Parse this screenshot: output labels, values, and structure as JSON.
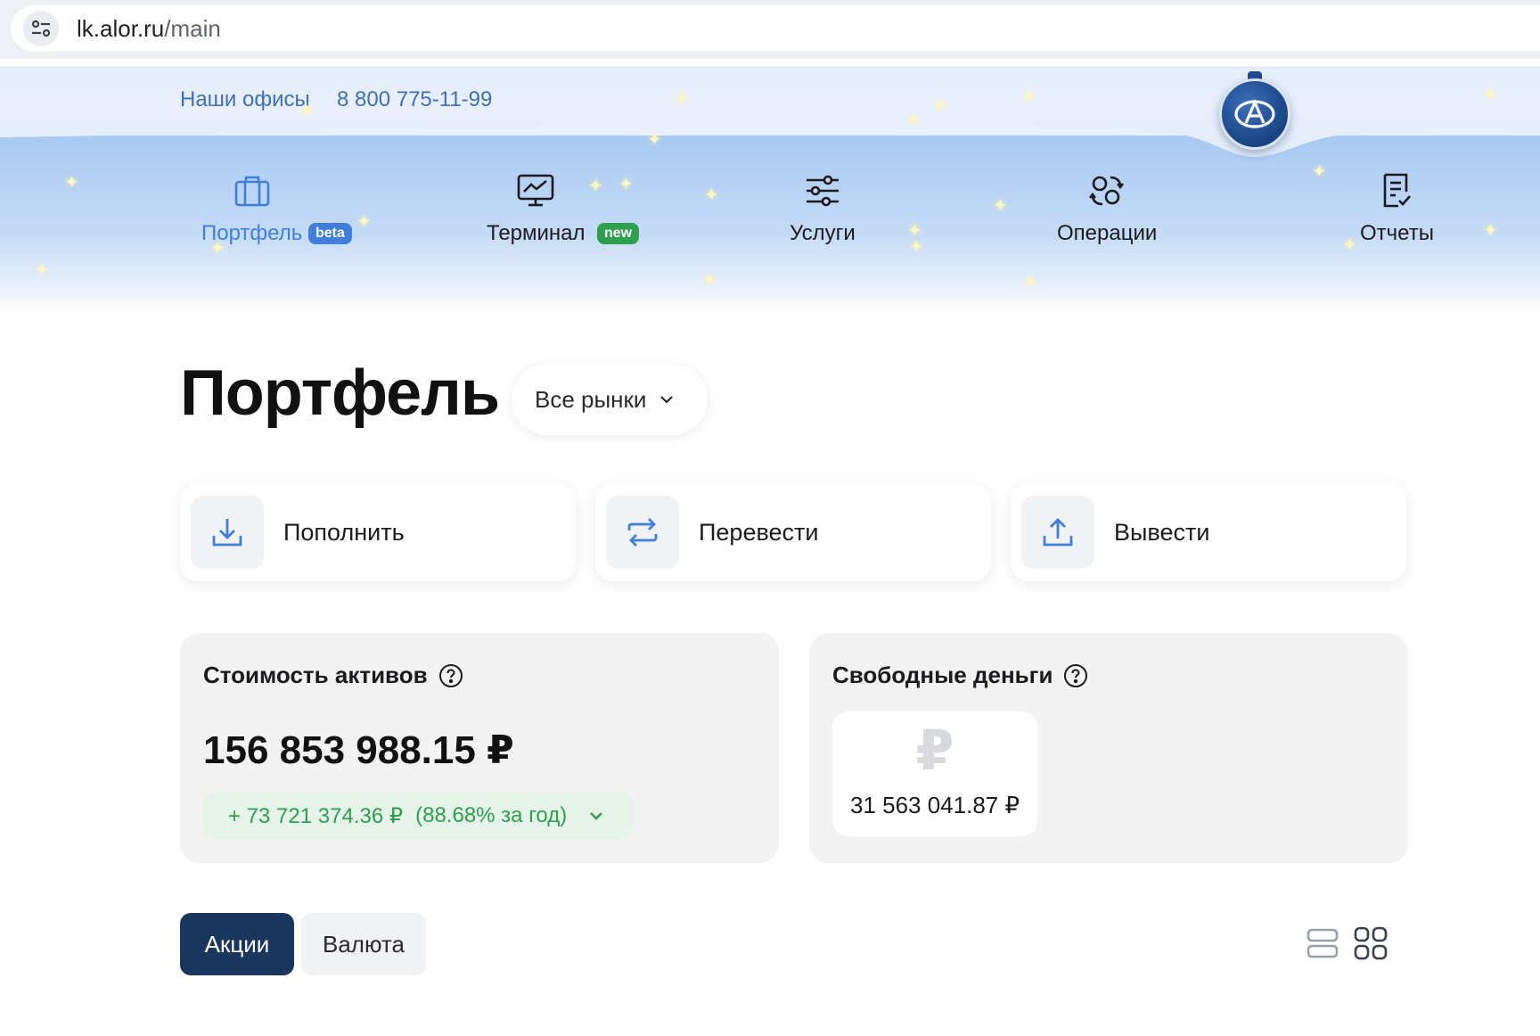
{
  "browser": {
    "url_host": "lk.alor.ru",
    "url_path": "/main",
    "site_settings_icon": "tune-icon"
  },
  "header": {
    "offices_link": "Наши офисы",
    "phone": "8 800 775-11-99",
    "logo_icon": "alor-logo-icon"
  },
  "nav": [
    {
      "label": "Портфель",
      "icon": "briefcase-icon",
      "badge": "beta",
      "active": true
    },
    {
      "label": "Терминал",
      "icon": "chart-monitor-icon",
      "badge": "new",
      "active": false
    },
    {
      "label": "Услуги",
      "icon": "sliders-icon",
      "badge": "",
      "active": false
    },
    {
      "label": "Операции",
      "icon": "exchange-icon",
      "badge": "",
      "active": false
    },
    {
      "label": "Отчеты",
      "icon": "report-icon",
      "badge": "",
      "active": false
    }
  ],
  "page": {
    "title": "Портфель",
    "market_filter": "Все рынки"
  },
  "actions": [
    {
      "label": "Пополнить",
      "icon": "download-icon"
    },
    {
      "label": "Перевести",
      "icon": "transfer-icon"
    },
    {
      "label": "Вывести",
      "icon": "upload-icon"
    }
  ],
  "assets": {
    "title": "Стоимость активов",
    "value": "156 853 988.15 ₽",
    "gain": "+ 73 721 374.36 ₽",
    "gain_pct": "(88.68% за год)"
  },
  "free_money": {
    "title": "Свободные деньги",
    "currency_symbol": "₽",
    "value": "31 563 041.87 ₽"
  },
  "tabs": {
    "active": "Акции",
    "inactive": "Валюта"
  },
  "colors": {
    "accent_blue": "#3f7fdb",
    "navy": "#1b365d",
    "gain_green": "#2e9e4f",
    "new_badge": "#2e9e4f"
  }
}
